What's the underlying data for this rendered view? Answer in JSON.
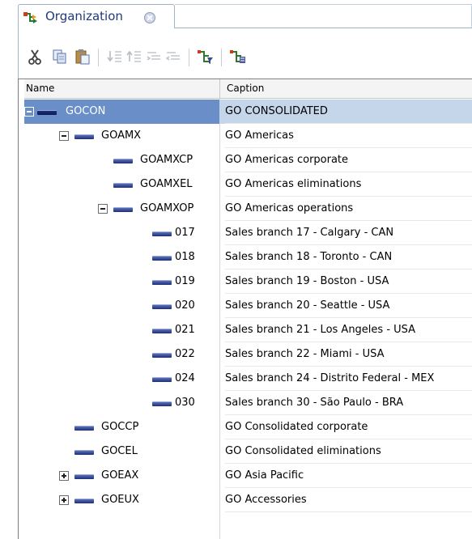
{
  "tab": {
    "label": "Organization"
  },
  "toolbar": {
    "buttons": [
      "cut-icon",
      "copy-icon",
      "paste-icon",
      "move-down-icon",
      "move-up-icon",
      "indent-icon",
      "outdent-icon",
      "filter-hierarchy-icon",
      "member-properties-icon"
    ]
  },
  "grid": {
    "columns": [
      "Name",
      "Caption"
    ],
    "rows": [
      {
        "name": "GOCON",
        "caption": "GO CONSOLIDATED",
        "level": 0,
        "expander": "minus",
        "selected": true
      },
      {
        "name": "GOAMX",
        "caption": "GO Americas",
        "level": 1,
        "expander": "minus"
      },
      {
        "name": "GOAMXCP",
        "caption": "GO Americas corporate",
        "level": 2,
        "expander": "none"
      },
      {
        "name": "GOAMXEL",
        "caption": "GO Americas eliminations",
        "level": 2,
        "expander": "none"
      },
      {
        "name": "GOAMXOP",
        "caption": "GO Americas operations",
        "level": 2,
        "expander": "minus"
      },
      {
        "name": "017",
        "caption": "Sales branch 17 - Calgary - CAN",
        "level": 3,
        "expander": "none"
      },
      {
        "name": "018",
        "caption": "Sales branch 18 - Toronto - CAN",
        "level": 3,
        "expander": "none"
      },
      {
        "name": "019",
        "caption": "Sales branch 19 - Boston - USA",
        "level": 3,
        "expander": "none"
      },
      {
        "name": "020",
        "caption": "Sales branch 20 - Seattle - USA",
        "level": 3,
        "expander": "none"
      },
      {
        "name": "021",
        "caption": "Sales branch 21 - Los Angeles - USA",
        "level": 3,
        "expander": "none"
      },
      {
        "name": "022",
        "caption": "Sales branch 22 - Miami - USA",
        "level": 3,
        "expander": "none"
      },
      {
        "name": "024",
        "caption": "Sales branch 24 - Distrito Federal - MEX",
        "level": 3,
        "expander": "none"
      },
      {
        "name": "030",
        "caption": "Sales branch 30 - São Paulo - BRA",
        "level": 3,
        "expander": "none"
      },
      {
        "name": "GOCCP",
        "caption": "GO Consolidated corporate",
        "level": 1,
        "expander": "none"
      },
      {
        "name": "GOCEL",
        "caption": "GO Consolidated eliminations",
        "level": 1,
        "expander": "none"
      },
      {
        "name": "GOEAX",
        "caption": "GO Asia Pacific",
        "level": 1,
        "expander": "plus"
      },
      {
        "name": "GOEUX",
        "caption": "GO Accessories",
        "level": 1,
        "expander": "plus"
      }
    ]
  }
}
